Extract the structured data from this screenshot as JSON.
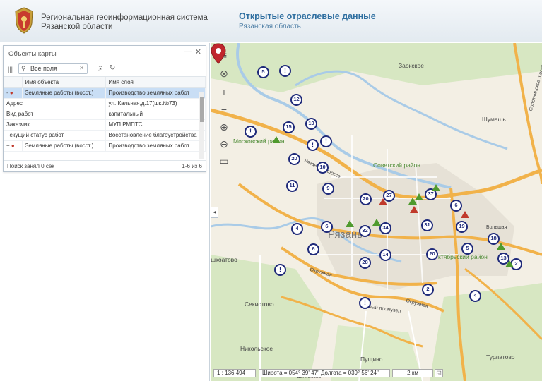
{
  "header": {
    "brand_line1": "Региональная геоинформационная система",
    "brand_line2": "Рязанской области",
    "section_title": "Открытые отраслевые данные",
    "section_subtitle": "Рязанская область"
  },
  "panel": {
    "title": "Объекты карты",
    "search_placeholder": "Все поля",
    "columns": [
      "Имя объекта",
      "Имя слоя"
    ],
    "rows": [
      {
        "name": "Земляные работы (восст.)",
        "layer": "Производство земляных работ",
        "selected": true
      },
      {
        "name": "Земляные работы (восст.)",
        "layer": "Производство земляных работ",
        "selected": false
      }
    ],
    "details": [
      {
        "key": "Адрес",
        "value": "ул. Кальная,д.17(шк.№73)"
      },
      {
        "key": "Вид работ",
        "value": "капитальный"
      },
      {
        "key": "Заказчик",
        "value": "МУП РМПТС"
      },
      {
        "key": "Текущий статус работ",
        "value": "Восстановление благоустройства"
      }
    ],
    "footer_left": "Поиск занял 0 сек",
    "footer_right": "1-6 из 6"
  },
  "map": {
    "labels": {
      "zaokskoe": "Заокское",
      "moskovsky": "Московский район",
      "sovetsky": "Советский район",
      "shumash": "Шумашь",
      "ryazan": "Рязань",
      "oktyabrsky": "ктябрьский район",
      "bolshaya": "Большая",
      "okruzhnaya": "Окружная",
      "okruzhnaya2": "Окружная",
      "shkolnaya": "Южный промузел",
      "ushkovatovo": "ушкоатово",
      "sekiotovo": "Секиотово",
      "nikolskoe": "Никольское",
      "pushchino": "Пущино",
      "turlatovo": "Турлатово",
      "dyakonovo": "Дьяконово",
      "road_ryaz": "Рязанское шоссе",
      "solot": "Солотчинское шоссе"
    },
    "markers": [
      {
        "t": "5"
      },
      {
        "t": "!"
      },
      {
        "t": "12"
      },
      {
        "t": "15"
      },
      {
        "t": "10"
      },
      {
        "t": "!"
      },
      {
        "t": "!"
      },
      {
        "t": "!"
      },
      {
        "t": "20"
      },
      {
        "t": "10"
      },
      {
        "t": "11"
      },
      {
        "t": "9"
      },
      {
        "t": "20"
      },
      {
        "t": "27"
      },
      {
        "t": "37"
      },
      {
        "t": "6"
      },
      {
        "t": "4"
      },
      {
        "t": "6"
      },
      {
        "t": "32"
      },
      {
        "t": "34"
      },
      {
        "t": "31"
      },
      {
        "t": "19"
      },
      {
        "t": "6"
      },
      {
        "t": "14"
      },
      {
        "t": "20"
      },
      {
        "t": "5"
      },
      {
        "t": "18"
      },
      {
        "t": "13"
      },
      {
        "t": "2"
      },
      {
        "t": "28"
      },
      {
        "t": "!"
      },
      {
        "t": "2"
      },
      {
        "t": "4"
      },
      {
        "t": "!"
      }
    ],
    "scale": "1 : 136 494",
    "coords": "Широта = 054° 39' 47\"  Долгота = 039° 56' 24\"",
    "scale_bar": "2 км",
    "colors": {
      "water": "#aacbe8",
      "roads_major": "#f1b24a",
      "green": "#cfe3b3",
      "urban": "#e3dfd6",
      "marker": "#1f2a7a"
    }
  }
}
